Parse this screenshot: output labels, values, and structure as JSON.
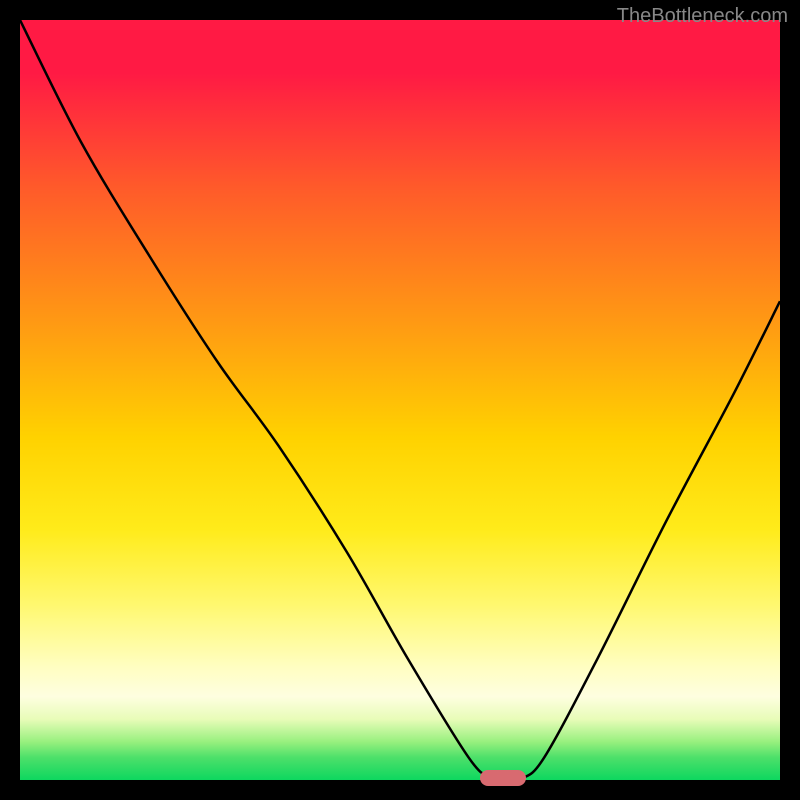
{
  "watermark": "TheBottleneck.com",
  "chart_data": {
    "type": "line",
    "title": "",
    "xlabel": "",
    "ylabel": "",
    "xlim": [
      0,
      100
    ],
    "ylim": [
      0,
      100
    ],
    "series": [
      {
        "name": "bottleneck-curve",
        "x": [
          0,
          8,
          17,
          26,
          34,
          43,
          51,
          59,
          62,
          63.5,
          66,
          69,
          76,
          85,
          94,
          100
        ],
        "y": [
          100,
          84,
          69,
          55,
          44,
          30,
          16,
          3,
          0.2,
          0,
          0.2,
          3,
          16,
          34,
          51,
          63
        ]
      }
    ],
    "marker": {
      "x": 63.5,
      "y": 0,
      "color": "#d86a70"
    },
    "gradient_stops": [
      {
        "pos": 0,
        "color": "#ff1a44"
      },
      {
        "pos": 7,
        "color": "#ff1a44"
      },
      {
        "pos": 22,
        "color": "#ff5a2a"
      },
      {
        "pos": 40,
        "color": "#ff9a13"
      },
      {
        "pos": 55,
        "color": "#ffd200"
      },
      {
        "pos": 67,
        "color": "#ffeb1a"
      },
      {
        "pos": 77,
        "color": "#fff870"
      },
      {
        "pos": 85,
        "color": "#fffec0"
      },
      {
        "pos": 89,
        "color": "#fefee0"
      },
      {
        "pos": 92,
        "color": "#e8fcb8"
      },
      {
        "pos": 95,
        "color": "#97f07e"
      },
      {
        "pos": 97,
        "color": "#4ee06a"
      },
      {
        "pos": 100,
        "color": "#0dd75f"
      }
    ]
  }
}
